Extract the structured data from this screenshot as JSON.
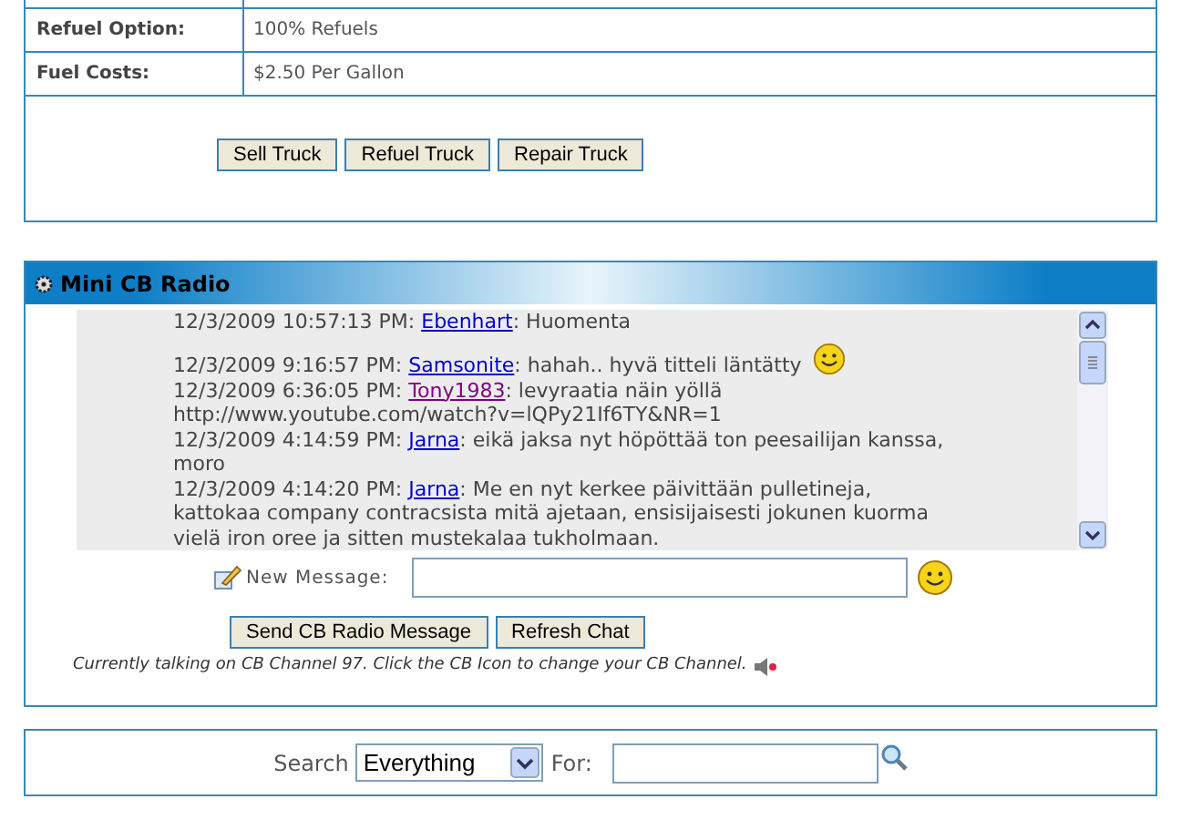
{
  "truck_details": {
    "rows": [
      {
        "label": "Refuel Option:",
        "value": "100% Refuels"
      },
      {
        "label": "Fuel Costs:",
        "value": "$2.50 Per Gallon"
      }
    ],
    "buttons": [
      "Sell Truck",
      "Refuel Truck",
      "Repair Truck"
    ]
  },
  "cb_radio": {
    "title": "Mini CB Radio",
    "messages": [
      {
        "time": "12/3/2009 10:57:13 PM: ",
        "user": "Ebenhart",
        "visited": false,
        "text": ": Huomenta",
        "smiley": false
      },
      {
        "time": "12/3/2009 9:16:57 PM: ",
        "user": "Samsonite",
        "visited": false,
        "text": ": hahah.. hyvä titteli läntätty",
        "smiley": true
      },
      {
        "time": "12/3/2009 6:36:05 PM: ",
        "user": "Tony1983",
        "visited": true,
        "text": ": levyraatia näin yöllä http://www.youtube.com/watch?v=lQPy21If6TY&NR=1",
        "smiley": false
      },
      {
        "time": "12/3/2009 4:14:59 PM: ",
        "user": "Jarna",
        "visited": false,
        "text": ": eikä jaksa nyt höpöttää ton peesailijan kanssa, moro",
        "smiley": false
      },
      {
        "time": "12/3/2009 4:14:20 PM: ",
        "user": "Jarna",
        "visited": false,
        "text": ": Me en nyt kerkee päivittään pulletineja, kattokaa company contracsista mitä ajetaan, ensisijaisesti jokunen kuorma vielä iron oree ja sitten mustekalaa tukholmaan.",
        "smiley": false
      }
    ],
    "new_message_label": "New Message:",
    "buttons": [
      "Send CB Radio Message",
      "Refresh Chat"
    ],
    "channel_note": "Currently talking on CB Channel 97. Click the CB Icon to change your CB Channel."
  },
  "search": {
    "label": "Search",
    "category": "Everything",
    "for_label": "For:"
  }
}
